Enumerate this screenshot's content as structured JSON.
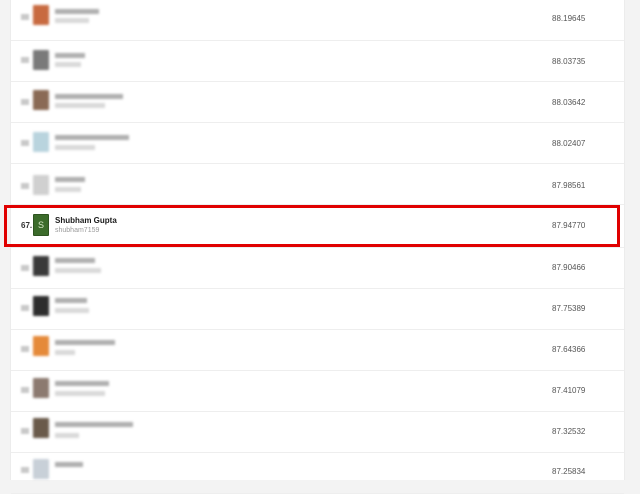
{
  "leaderboard": {
    "rows": [
      {
        "score": "88.19645",
        "avatar_color": "#c86a40"
      },
      {
        "score": "88.03735",
        "avatar_color": "#7a7a7a"
      },
      {
        "score": "88.03642",
        "avatar_color": "#8a6a55"
      },
      {
        "score": "88.02407",
        "avatar_color": "#b9d4de"
      },
      {
        "score": "87.98561",
        "avatar_color": "#d0d0d0"
      },
      {
        "score": "87.94770",
        "rank": "67.",
        "name": "Shubham Gupta",
        "username": "shubham7159",
        "avatar_letter": "S",
        "avatar_color": "#3b6b2a",
        "highlighted": true
      },
      {
        "score": "87.90466",
        "avatar_color": "#3a3a3a"
      },
      {
        "score": "87.75389",
        "avatar_color": "#2d2d2d"
      },
      {
        "score": "87.64366",
        "avatar_color": "#e58a3a"
      },
      {
        "score": "87.41079",
        "avatar_color": "#8c7a70"
      },
      {
        "score": "87.32532",
        "avatar_color": "#6a5a4a"
      },
      {
        "score": "87.25834",
        "avatar_color": "#c8d0d8"
      }
    ]
  },
  "colors": {
    "highlight_border": "#e00000",
    "background": "#f3f3f3",
    "panel": "#ffffff"
  }
}
